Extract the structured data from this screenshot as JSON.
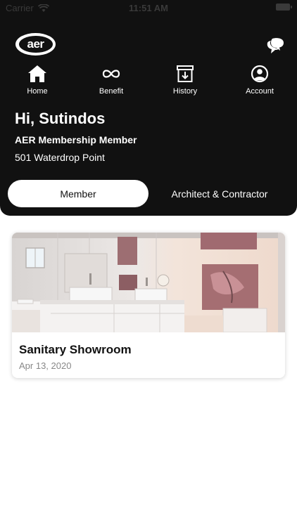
{
  "status_bar": {
    "carrier": "Carrier",
    "time": "11:51 AM"
  },
  "header": {
    "logo_text": "aer"
  },
  "nav": {
    "items": [
      {
        "label": "Home",
        "icon": "home-icon"
      },
      {
        "label": "Benefit",
        "icon": "infinity-icon"
      },
      {
        "label": "History",
        "icon": "archive-download-icon"
      },
      {
        "label": "Account",
        "icon": "account-icon"
      }
    ]
  },
  "profile": {
    "greeting": "Hi, Sutindos",
    "membership": "AER Membership Member",
    "address": "501 Waterdrop Point"
  },
  "tabs": [
    {
      "label": "Member",
      "selected": true
    },
    {
      "label": "Architect & Contractor",
      "selected": false
    }
  ],
  "cards": [
    {
      "title": "Sanitary Showroom",
      "date": "Apr 13, 2020",
      "image": "bathroom-showroom-photo"
    }
  ],
  "colors": {
    "header_bg": "#111111",
    "accent": "#ffffff",
    "date_gray": "#888888"
  }
}
